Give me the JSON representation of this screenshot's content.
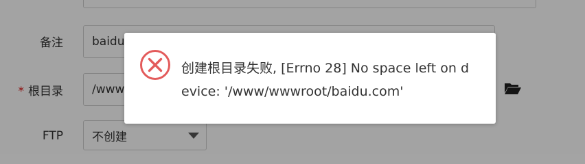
{
  "form": {
    "remark_label": "备注",
    "remark_value": "baidu",
    "root_dir_required_mark": "*",
    "root_dir_label": "根目录",
    "root_dir_value": "/www",
    "ftp_label": "FTP",
    "ftp_value": "不创建"
  },
  "dialog": {
    "message": "创建根目录失败, [Errno 28] No space left on device: '/www/wwwroot/baidu.com'",
    "icon": "error-x-circle-icon"
  },
  "icons": {
    "folder": "folder-open-icon",
    "select_arrow": "chevron-down-icon"
  },
  "colors": {
    "error": "#e35b5b",
    "overlay": "rgba(0,0,0,0.36)",
    "required": "#dd1111"
  }
}
